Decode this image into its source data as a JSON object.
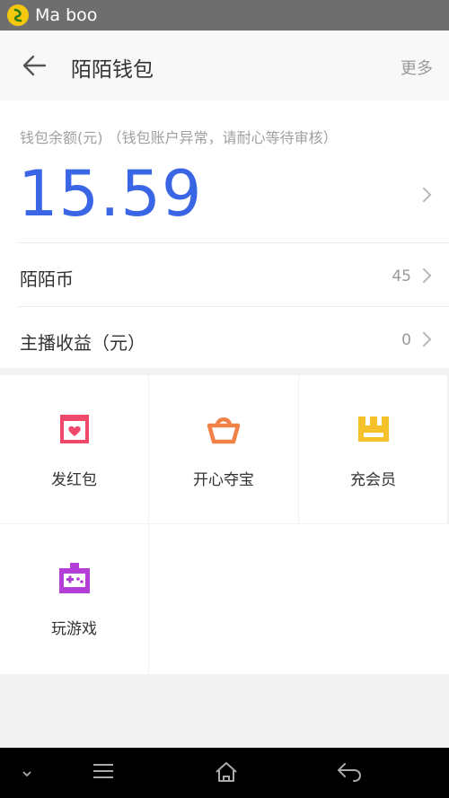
{
  "status_bar": {
    "app_name": "Ma boo"
  },
  "header": {
    "title": "陌陌钱包",
    "more_label": "更多"
  },
  "balance": {
    "label": "钱包余额(元) （钱包账户异常，请耐心等待审核）",
    "value": "15.59"
  },
  "rows": [
    {
      "label": "陌陌币",
      "value": "45"
    },
    {
      "label": "主播收益（元）",
      "value": "0"
    }
  ],
  "grid": [
    {
      "label": "发红包",
      "icon": "red-envelope-icon",
      "color": "#f0486a"
    },
    {
      "label": "开心夺宝",
      "icon": "gold-ingot-icon",
      "color": "#f08248"
    },
    {
      "label": "充会员",
      "icon": "crown-icon",
      "color": "#f5c12a"
    },
    {
      "label": "玩游戏",
      "icon": "game-controller-icon",
      "color": "#b43fd6"
    }
  ],
  "colors": {
    "accent": "#3a66e6",
    "status_bar": "#6e6e6e",
    "nav_bar": "#000000"
  }
}
